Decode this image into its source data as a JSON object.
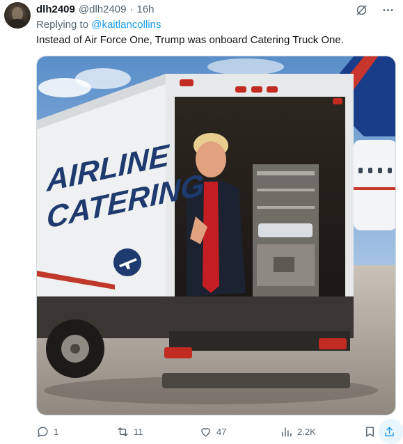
{
  "tweet": {
    "display_name": "dlh2409",
    "handle": "@dlh2409",
    "separator": "·",
    "time": "16h",
    "reply_prefix": "Replying to ",
    "reply_mention": "@kaitlancollins",
    "text": "Instead of Air Force One, Trump was onboard Catering Truck One.",
    "image": {
      "truck_text_line1": "AIRLINE",
      "truck_text_line2": "CATERING"
    },
    "actions": {
      "replies": "1",
      "retweets": "11",
      "likes": "47",
      "views": "2.2K"
    }
  },
  "colors": {
    "accent": "#1d9bf0",
    "muted": "#536471",
    "text": "#0f1419",
    "logo_navy": "#1f3a6e",
    "stripe_red": "#c0392b"
  },
  "icons": [
    "grok-icon",
    "more-icon",
    "reply-icon",
    "retweet-icon",
    "like-icon",
    "views-icon",
    "bookmark-icon",
    "share-icon"
  ]
}
